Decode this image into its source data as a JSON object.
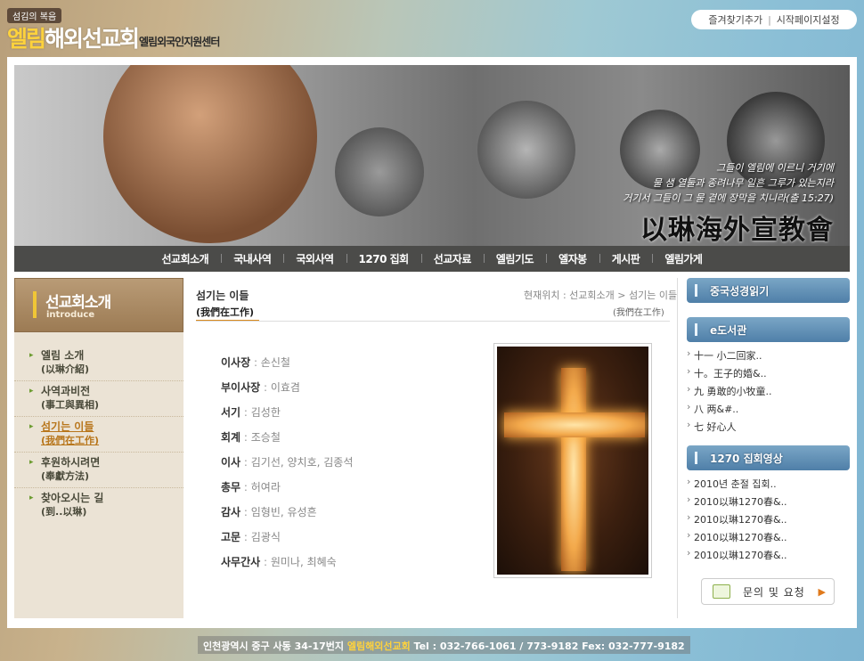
{
  "header": {
    "tagline": "섬김의 복음",
    "logo_accent": "엘림",
    "logo_rest": "해외선교회",
    "subtitle": "엘림외국인지원센터",
    "top_links": [
      "즐겨찾기추가",
      "시작페이지설정"
    ]
  },
  "banner": {
    "verse": [
      "그들이 엘림에 이르니 거기에",
      "물 샘 열둘과 종려나무 일흔 그루가 있는지라",
      "거기서 그들이 그 물 곁에 장막을 치니라(출 15:27)"
    ],
    "calligraphy": "以琳海外宣教會"
  },
  "nav": [
    "선교회소개",
    "국내사역",
    "국외사역",
    "1270 집회",
    "선교자료",
    "엘림기도",
    "엘자봉",
    "게시판",
    "엘림가게"
  ],
  "left": {
    "heading": "선교회소개",
    "heading_en": "introduce",
    "menu": [
      {
        "l1": "엘림 소개",
        "l2": "(以琳介紹)",
        "active": false
      },
      {
        "l1": "사역과비전",
        "l2": "(事工與異相)",
        "active": false
      },
      {
        "l1": "섬기는 이들",
        "l2": "(我們在工作)",
        "active": true
      },
      {
        "l1": "후원하시려면",
        "l2": "(奉獻方法)",
        "active": false
      },
      {
        "l1": "찾아오시는 길",
        "l2": "(到..以琳)",
        "active": false
      }
    ]
  },
  "content": {
    "title": "섬기는 이들",
    "subtitle": "(我們在工作)",
    "breadcrumb": "현재위치 : 선교회소개 > 섬기는 이들",
    "breadcrumb_sub": "(我們在工作)",
    "staff": [
      {
        "role": "이사장",
        "names": "손신철"
      },
      {
        "role": "부이사장",
        "names": "이효겸"
      },
      {
        "role": "서기",
        "names": "김성한"
      },
      {
        "role": "회계",
        "names": "조승철"
      },
      {
        "role": "이사",
        "names": "김기선, 양치호, 김종석"
      },
      {
        "role": "총무",
        "names": "허여라"
      },
      {
        "role": "감사",
        "names": "임형빈, 유성흔"
      },
      {
        "role": "고문",
        "names": "김광식"
      },
      {
        "role": "사무간사",
        "names": "원미나, 최혜숙"
      }
    ]
  },
  "right": {
    "box1": "중국성경읽기",
    "box2": "e도서관",
    "box2_items": [
      "十一 小二回家..",
      "十。王子的婚&..",
      "九 勇敢的小牧童..",
      "八 两&#..",
      "七 好心人"
    ],
    "box3": "1270 집회영상",
    "box3_items": [
      "2010년 춘절 집회..",
      "2010以琳1270春&..",
      "2010以琳1270春&..",
      "2010以琳1270春&..",
      "2010以琳1270春&.."
    ],
    "inquiry": "문의 및 요청"
  },
  "footer": {
    "address": "인천광역시 중구 사동 34-17번지",
    "org": "엘림해외선교회",
    "contact": "Tel : 032-766-1061 / 773-9182 Fex: 032-777-9182"
  },
  "colors": {
    "nav_bg": "#4b4b49",
    "left_bg": "#ebe3d5",
    "right_header": "#5b8ab1",
    "active_menu": "#b8761b",
    "accent": "#ffd23c"
  }
}
